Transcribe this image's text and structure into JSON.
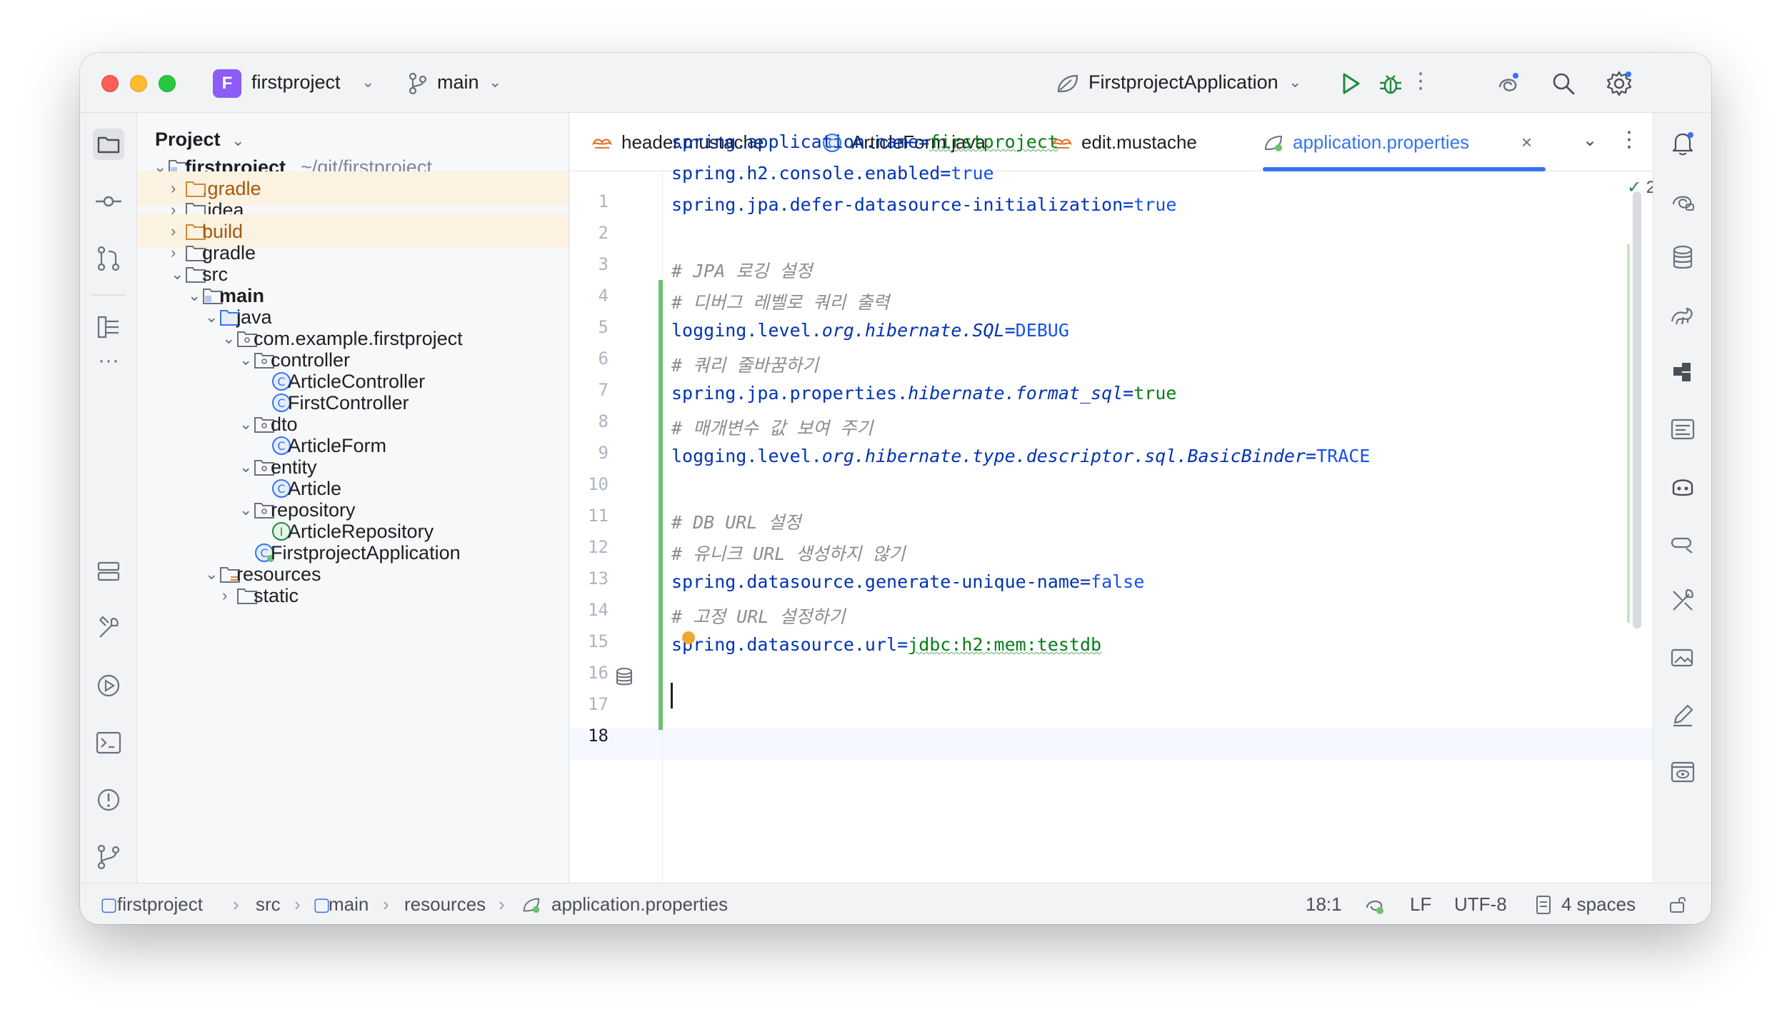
{
  "titlebar": {
    "project_badge": "F",
    "project_name": "firstproject",
    "branch": "main",
    "run_config": "FirstprojectApplication",
    "icons": [
      "branch-icon",
      "spring-run-config-icon",
      "run-icon",
      "debug-icon",
      "more-vertical-icon",
      "ai-assistant-icon",
      "search-icon",
      "settings-icon"
    ]
  },
  "left_strip": {
    "icons": [
      "project-folder-icon",
      "commit-icon",
      "pull-requests-icon",
      "structure-icon",
      "more-horizontal-icon",
      "services-icon",
      "build-tools-icon",
      "run-icon",
      "terminal-icon",
      "problems-icon",
      "git-icon"
    ]
  },
  "project_panel": {
    "title": "Project",
    "tree": [
      {
        "label": "firstproject",
        "sub": "~/git/firstproject",
        "bold": true
      },
      {
        "label": ".gradle",
        "orange": true
      },
      {
        "label": ".idea"
      },
      {
        "label": "build",
        "orange": true
      },
      {
        "label": "gradle"
      },
      {
        "label": "src"
      },
      {
        "label": "main",
        "bold": true
      },
      {
        "label": "java"
      },
      {
        "label": "com.example.firstproject"
      },
      {
        "label": "controller"
      },
      {
        "label": "ArticleController"
      },
      {
        "label": "FirstController"
      },
      {
        "label": "dto"
      },
      {
        "label": "ArticleForm"
      },
      {
        "label": "entity"
      },
      {
        "label": "Article"
      },
      {
        "label": "repository"
      },
      {
        "label": "ArticleRepository"
      },
      {
        "label": "FirstprojectApplication"
      },
      {
        "label": "resources"
      },
      {
        "label": "static"
      }
    ]
  },
  "editor": {
    "tabs": [
      {
        "label": "header.mustache"
      },
      {
        "label": "ArticleForm.java"
      },
      {
        "label": "edit.mustache"
      },
      {
        "label": "application.properties",
        "active": true
      }
    ],
    "inspection_count": "2",
    "line_numbers": [
      "1",
      "2",
      "3",
      "4",
      "5",
      "6",
      "7",
      "8",
      "9",
      "10",
      "11",
      "12",
      "13",
      "14",
      "15",
      "16",
      "17",
      "18"
    ],
    "lines": {
      "l1_key": "spring.application.name",
      "l1_eq": "=",
      "l1_val": "firstproject",
      "l2_key": "spring.h2.console.enabled",
      "l2_eq": "=",
      "l2_val": "true",
      "l3_key": "spring.jpa.defer-datasource-initialization",
      "l3_eq": "=",
      "l3_val": "true",
      "l5": "# JPA 로깅 설정",
      "l6": "# 디버그 레벨로 쿼리 출력",
      "l7_a": "logging.level.",
      "l7_b": "org.hibernate.SQL",
      "l7_eq": "=",
      "l7_val": "DEBUG",
      "l8": "# 쿼리 줄바꿈하기",
      "l9_a": "spring.jpa.properties.",
      "l9_b": "hibernate.format_sql",
      "l9_eq": "=",
      "l9_val": "true",
      "l10": "# 매개변수 값 보여 주기",
      "l11_a": "logging.level.",
      "l11_b": "org.hibernate.type.descriptor.sql.BasicBinder",
      "l11_eq": "=",
      "l11_val": "TRACE",
      "l13": "# DB URL 설정",
      "l14": "# 유니크 URL 생성하지 않기",
      "l15_key": "spring.datasource.generate-unique-name",
      "l15_eq": "=",
      "l15_val": "false",
      "l16": "# 고정 URL 설정하기",
      "l17_key": "spring.datasource.url",
      "l17_eq": "=",
      "l17_val": "jdbc:h2:mem:testdb"
    }
  },
  "right_strip": {
    "icons": [
      "notifications-icon",
      "ai-chat-icon",
      "database-icon",
      "gradle-icon",
      "plugin-icon",
      "markdown-preview-icon",
      "copilot-icon",
      "endpoints-icon",
      "tools-icon",
      "image-icon",
      "edit-icon",
      "preview-icon"
    ]
  },
  "statusbar": {
    "breadcrumb": [
      "firstproject",
      "src",
      "main",
      "resources",
      "application.properties"
    ],
    "position": "18:1",
    "line_sep": "LF",
    "encoding": "UTF-8",
    "indent": "4 spaces"
  },
  "colors": {
    "accent": "#3574f0",
    "folder_excluded": "#a3580f",
    "change_marker": "#6cc270"
  }
}
